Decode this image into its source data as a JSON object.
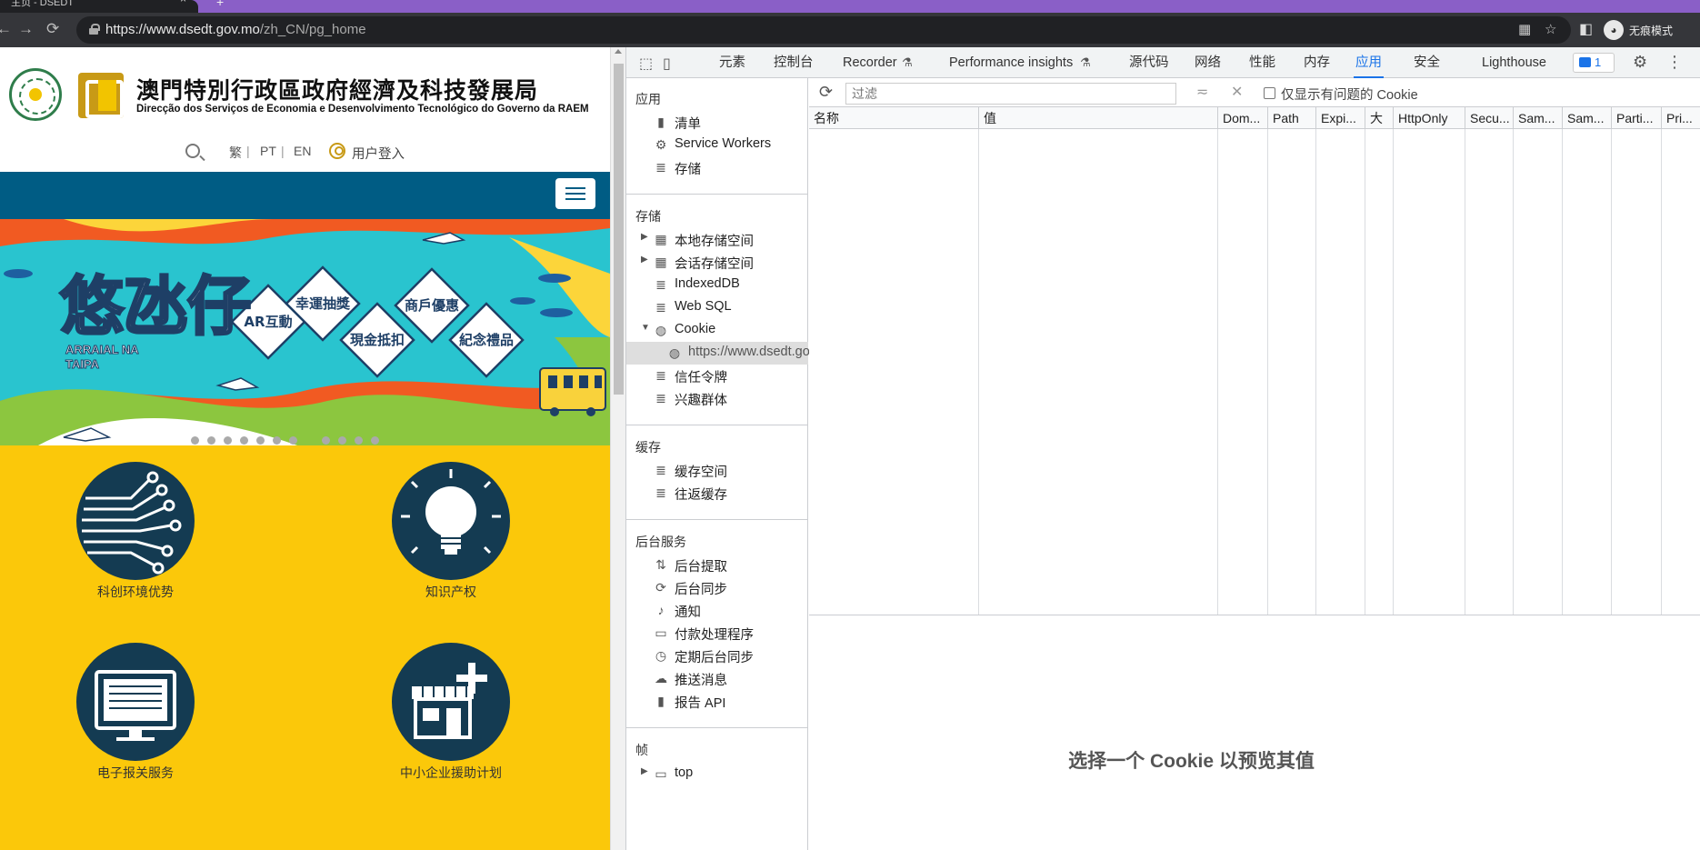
{
  "browser": {
    "tab_title": "主页 - DSEDT",
    "url_host": "https://www.dsedt.gov.mo",
    "url_path": "/zh_CN/pg_home",
    "profile_label": "无痕模式"
  },
  "site": {
    "title_cn": "澳門特別行政區政府經濟及科技發展局",
    "title_pt": "Direcção dos Serviços de Economia e Desenvolvimento Tecnológico do Governo da RAEM",
    "lang_tc": "繁",
    "lang_pt": "PT",
    "lang_en": "EN",
    "login_label": "用户登入",
    "banner": {
      "title": "悠氹仔",
      "subtitle_1": "ARRAIAL NA",
      "subtitle_2": "TAIPA",
      "tiles": [
        "AR互動",
        "幸運抽獎",
        "現金抵扣",
        "商戶優惠",
        "紀念禮品"
      ]
    },
    "features": [
      {
        "label": "科创环境优势",
        "icon": "circuit-icon"
      },
      {
        "label": "知识产权",
        "icon": "lightbulb-icon"
      },
      {
        "label": "电子报关服务",
        "icon": "computer-icon"
      },
      {
        "label": "中小企业援助计划",
        "icon": "store-plus-icon"
      }
    ]
  },
  "devtools": {
    "tabs": [
      "元素",
      "控制台",
      "Recorder",
      "Performance insights",
      "源代码",
      "网络",
      "性能",
      "内存",
      "应用",
      "安全",
      "Lighthouse"
    ],
    "active_tab": "应用",
    "issues_count": "1",
    "sidebar": {
      "app_title": "应用",
      "app_items": [
        "清单",
        "Service Workers",
        "存储"
      ],
      "storage_title": "存储",
      "storage_items": [
        "本地存储空间",
        "会话存储空间",
        "IndexedDB",
        "Web SQL",
        "Cookie",
        "https://www.dsedt.gov.mo",
        "信任令牌",
        "兴趣群体"
      ],
      "cache_title": "缓存",
      "cache_items": [
        "缓存空间",
        "往返缓存"
      ],
      "bg_title": "后台服务",
      "bg_items": [
        "后台提取",
        "后台同步",
        "通知",
        "付款处理程序",
        "定期后台同步",
        "推送消息",
        "报告 API"
      ],
      "frames_title": "帧",
      "frames_items": [
        "top"
      ]
    },
    "filter_placeholder": "过滤",
    "only_issues_label": "仅显示有问题的 Cookie",
    "columns": [
      "名称",
      "值",
      "Dom...",
      "Path",
      "Expi...",
      "大",
      "HttpOnly",
      "Secu...",
      "Sam...",
      "Sam...",
      "Parti...",
      "Pri..."
    ],
    "preview_message": "选择一个 Cookie 以预览其值"
  }
}
